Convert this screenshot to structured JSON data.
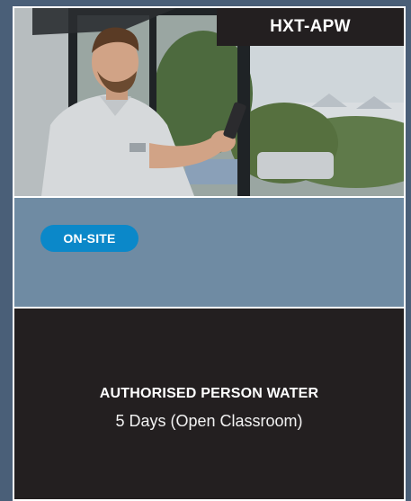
{
  "course": {
    "code": "HXT-APW",
    "delivery_tag": "ON-SITE",
    "title": "AUTHORISED PERSON WATER",
    "duration": "5 Days (Open Classroom)"
  },
  "colors": {
    "page_background": "#4a5f78",
    "panel_dark": "#231f20",
    "panel_mid": "#6f8ba3",
    "tag_blue": "#0b88c9",
    "border": "#ffffff"
  }
}
